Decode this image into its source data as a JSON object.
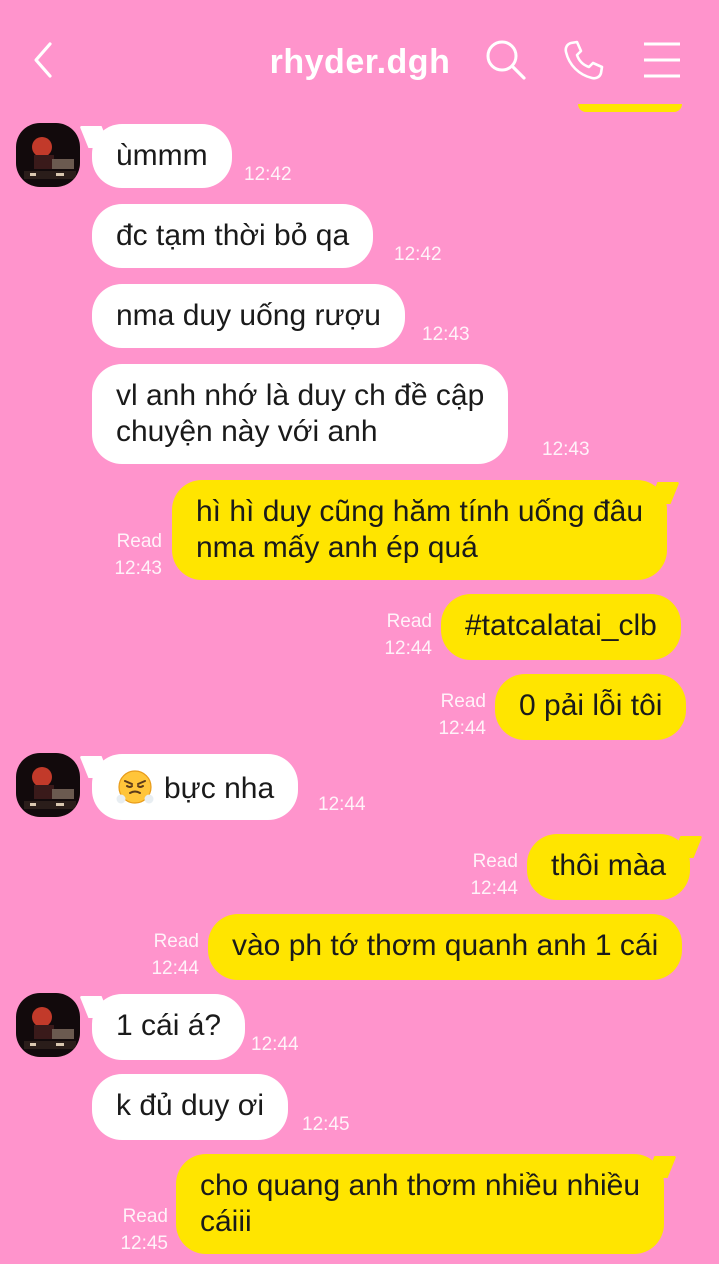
{
  "header": {
    "title": "rhyder.dgh",
    "back_icon": "chevron-left-icon",
    "search_icon": "search-icon",
    "call_icon": "phone-icon",
    "menu_icon": "hamburger-menu-icon"
  },
  "colors": {
    "background": "#FF94CC",
    "incoming_bubble": "#FFFFFF",
    "outgoing_bubble": "#FFE500"
  },
  "messages": [
    {
      "direction": "in",
      "text": "ùmmm",
      "time": "12:42"
    },
    {
      "direction": "in",
      "text": "đc tạm thời bỏ qa",
      "time": "12:42"
    },
    {
      "direction": "in",
      "text": "nma duy uống rượu",
      "time": "12:43"
    },
    {
      "direction": "in",
      "lines": [
        "vl anh nhớ là duy ch đề cập",
        "chuyện này với anh"
      ],
      "time": "12:43"
    },
    {
      "direction": "out",
      "lines": [
        "hì hì duy cũng hăm tính uống đâu",
        "nma mấy anh ép quá"
      ],
      "status": "Read",
      "time": "12:43"
    },
    {
      "direction": "out",
      "text": "#tatcalatai_clb",
      "status": "Read",
      "time": "12:44"
    },
    {
      "direction": "out",
      "text": "0 pải lỗi tôi",
      "status": "Read",
      "time": "12:44"
    },
    {
      "direction": "in",
      "emoji": "face-with-steam-icon",
      "text": "bực nha",
      "time": "12:44"
    },
    {
      "direction": "out",
      "text": "thôi màa",
      "status": "Read",
      "time": "12:44"
    },
    {
      "direction": "out",
      "text": "vào ph tớ thơm quanh anh 1 cái",
      "status": "Read",
      "time": "12:44"
    },
    {
      "direction": "in",
      "text": "1 cái á?",
      "time": "12:44"
    },
    {
      "direction": "in",
      "text": "k đủ duy ơi",
      "time": "12:45"
    },
    {
      "direction": "out",
      "lines": [
        "cho quang anh thơm nhiều nhiều",
        "cáiii"
      ],
      "status": "Read",
      "time": "12:45"
    }
  ]
}
